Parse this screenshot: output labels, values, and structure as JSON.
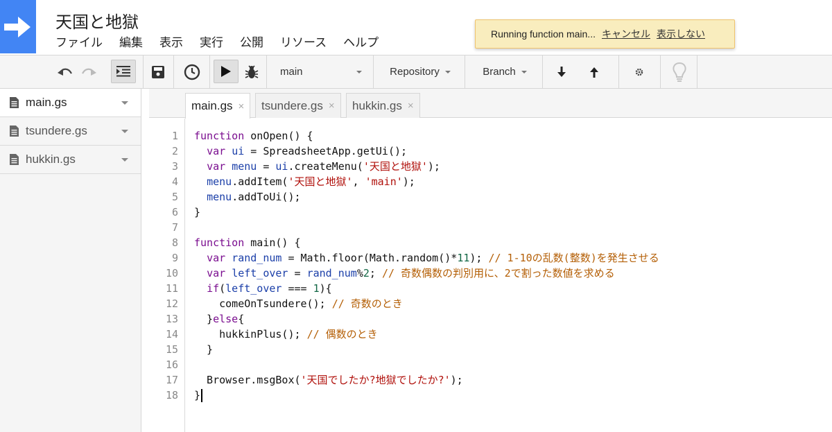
{
  "project": {
    "title": "天国と地獄"
  },
  "menu": [
    "ファイル",
    "編集",
    "表示",
    "実行",
    "公開",
    "リソース",
    "ヘルプ"
  ],
  "notice": {
    "message": "Running function main...",
    "cancel": "キャンセル",
    "dismiss": "表示しない",
    "background": "#f9edbe"
  },
  "toolbar": {
    "function_select": "main",
    "repository": "Repository",
    "branch": "Branch",
    "icons": [
      "undo-icon",
      "redo-icon",
      "indent-icon",
      "save-icon",
      "triggers-clock-icon",
      "run-icon",
      "debug-bug-icon",
      "download-arrow-icon",
      "upload-arrow-icon",
      "gear-icon",
      "lightbulb-icon"
    ]
  },
  "sidebar": {
    "files": [
      {
        "name": "main.gs",
        "active": true
      },
      {
        "name": "tsundere.gs",
        "active": false
      },
      {
        "name": "hukkin.gs",
        "active": false
      }
    ]
  },
  "tabs": [
    {
      "label": "main.gs",
      "close": "×",
      "active": true
    },
    {
      "label": "tsundere.gs",
      "close": "×",
      "active": false
    },
    {
      "label": "hukkin.gs",
      "close": "×",
      "active": false
    }
  ],
  "editor": {
    "line_numbers": [
      "1",
      "2",
      "3",
      "4",
      "5",
      "6",
      "7",
      "8",
      "9",
      "10",
      "11",
      "12",
      "13",
      "14",
      "15",
      "16",
      "17",
      "18"
    ],
    "lines": [
      [
        {
          "t": "function",
          "c": "kw"
        },
        {
          "t": " onOpen() {",
          "c": ""
        }
      ],
      [
        {
          "t": "  ",
          "c": ""
        },
        {
          "t": "var",
          "c": "kw"
        },
        {
          "t": " ",
          "c": ""
        },
        {
          "t": "ui",
          "c": "vr"
        },
        {
          "t": " = SpreadsheetApp.getUi();",
          "c": ""
        }
      ],
      [
        {
          "t": "  ",
          "c": ""
        },
        {
          "t": "var",
          "c": "kw"
        },
        {
          "t": " ",
          "c": ""
        },
        {
          "t": "menu",
          "c": "vr"
        },
        {
          "t": " = ",
          "c": ""
        },
        {
          "t": "ui",
          "c": "vr"
        },
        {
          "t": ".createMenu(",
          "c": ""
        },
        {
          "t": "'天国と地獄'",
          "c": "st"
        },
        {
          "t": ");",
          "c": ""
        }
      ],
      [
        {
          "t": "  ",
          "c": ""
        },
        {
          "t": "menu",
          "c": "vr"
        },
        {
          "t": ".addItem(",
          "c": ""
        },
        {
          "t": "'天国と地獄'",
          "c": "st"
        },
        {
          "t": ", ",
          "c": ""
        },
        {
          "t": "'main'",
          "c": "st"
        },
        {
          "t": ");",
          "c": ""
        }
      ],
      [
        {
          "t": "  ",
          "c": ""
        },
        {
          "t": "menu",
          "c": "vr"
        },
        {
          "t": ".addToUi();",
          "c": ""
        }
      ],
      [
        {
          "t": "}",
          "c": ""
        }
      ],
      [
        {
          "t": "",
          "c": ""
        }
      ],
      [
        {
          "t": "function",
          "c": "kw"
        },
        {
          "t": " main() {",
          "c": ""
        }
      ],
      [
        {
          "t": "  ",
          "c": ""
        },
        {
          "t": "var",
          "c": "kw"
        },
        {
          "t": " ",
          "c": ""
        },
        {
          "t": "rand_num",
          "c": "vr"
        },
        {
          "t": " = Math.floor(Math.random()*",
          "c": ""
        },
        {
          "t": "11",
          "c": "nm"
        },
        {
          "t": "); ",
          "c": ""
        },
        {
          "t": "// 1-10の乱数(整数)を発生させる",
          "c": "cm"
        }
      ],
      [
        {
          "t": "  ",
          "c": ""
        },
        {
          "t": "var",
          "c": "kw"
        },
        {
          "t": " ",
          "c": ""
        },
        {
          "t": "left_over",
          "c": "vr"
        },
        {
          "t": " = ",
          "c": ""
        },
        {
          "t": "rand_num",
          "c": "vr"
        },
        {
          "t": "%",
          "c": ""
        },
        {
          "t": "2",
          "c": "nm"
        },
        {
          "t": "; ",
          "c": ""
        },
        {
          "t": "// 奇数偶数の判別用に、2で割った数値を求める",
          "c": "cm"
        }
      ],
      [
        {
          "t": "  ",
          "c": ""
        },
        {
          "t": "if",
          "c": "kw"
        },
        {
          "t": "(",
          "c": ""
        },
        {
          "t": "left_over",
          "c": "vr"
        },
        {
          "t": " === ",
          "c": ""
        },
        {
          "t": "1",
          "c": "nm"
        },
        {
          "t": "){",
          "c": ""
        }
      ],
      [
        {
          "t": "    comeOnTsundere(); ",
          "c": ""
        },
        {
          "t": "// 奇数のとき",
          "c": "cm"
        }
      ],
      [
        {
          "t": "  }",
          "c": ""
        },
        {
          "t": "else",
          "c": "kw"
        },
        {
          "t": "{",
          "c": ""
        }
      ],
      [
        {
          "t": "    hukkinPlus(); ",
          "c": ""
        },
        {
          "t": "// 偶数のとき",
          "c": "cm"
        }
      ],
      [
        {
          "t": "  }",
          "c": ""
        }
      ],
      [
        {
          "t": "",
          "c": ""
        }
      ],
      [
        {
          "t": "  Browser.msgBox(",
          "c": ""
        },
        {
          "t": "'天国でしたか?地獄でしたか?'",
          "c": "st"
        },
        {
          "t": ");",
          "c": ""
        }
      ],
      [
        {
          "t": "}",
          "c": ""
        }
      ]
    ]
  }
}
